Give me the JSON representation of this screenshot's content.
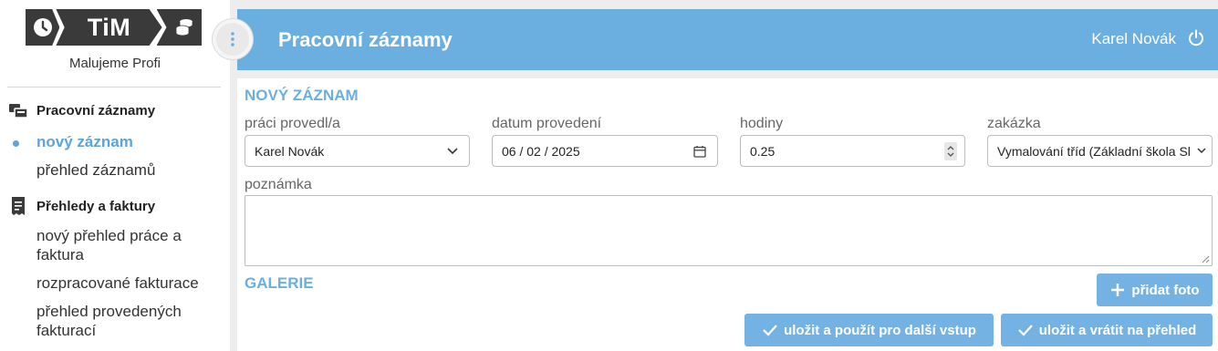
{
  "app": {
    "logo_text": "TiM",
    "company": "Malujeme Profi"
  },
  "sidebar": {
    "groups": [
      {
        "label": "Pracovní záznamy",
        "icon": "work-records-icon",
        "items": [
          {
            "label": "nový záznam",
            "active": true
          },
          {
            "label": "přehled záznamů",
            "active": false
          }
        ]
      },
      {
        "label": "Přehledy a faktury",
        "icon": "receipt-icon",
        "items": [
          {
            "label": "nový přehled práce a faktura",
            "active": false
          },
          {
            "label": "rozpracované fakturace",
            "active": false
          },
          {
            "label": "přehled provedených fakturací",
            "active": false
          }
        ]
      }
    ]
  },
  "header": {
    "title": "Pracovní záznamy",
    "user": "Karel Novák",
    "logout_icon": "power-icon"
  },
  "form": {
    "section_title": "NOVÝ ZÁZNAM",
    "worker_label": "práci provedl/a",
    "worker_value": "Karel Novák",
    "date_label": "datum provedení",
    "date_value": "06 / 02 / 2025",
    "hours_label": "hodiny",
    "hours_value": "0.25",
    "order_label": "zakázka",
    "order_value": "Vymalování tříd (Základní škola Slunečnice)",
    "note_label": "poznámka",
    "note_value": ""
  },
  "gallery": {
    "title": "GALERIE",
    "add_photo": "přidat foto"
  },
  "actions": {
    "save_continue": "uložit a použít pro další vstup",
    "save_return": "uložit a vrátit na přehled"
  },
  "colors": {
    "accent": "#6aafe0",
    "button": "#73b2e3",
    "logo_dark": "#3a3a3a"
  }
}
